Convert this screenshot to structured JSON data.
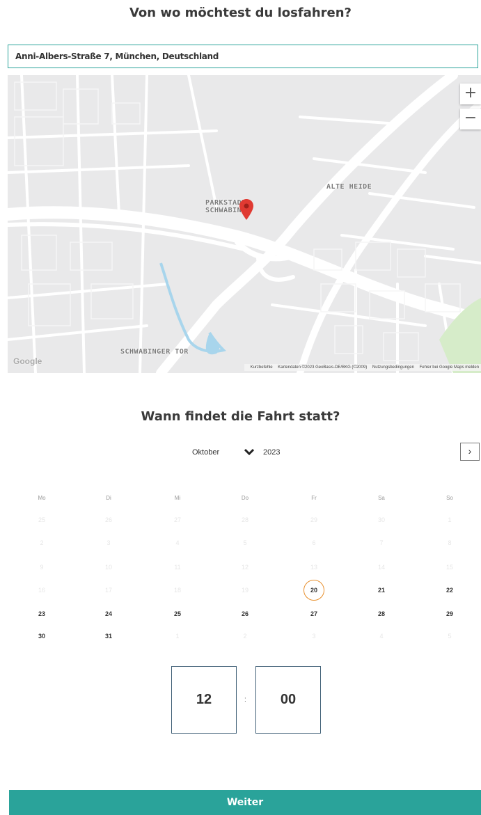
{
  "start": {
    "heading": "Von wo möchtest du losfahren?",
    "address_value": "Anni-Albers-Straße 7, München, Deutschland"
  },
  "map": {
    "zoom_in": "+",
    "zoom_out": "−",
    "labels": {
      "parkstadt_1": "PARKSTADT",
      "parkstadt_2": "SCHWABING",
      "alte_heide": "ALTE HEIDE",
      "schwabinger_tor": "SCHWABINGER TOR"
    },
    "logo": "Google",
    "attribution": {
      "shortcuts": "Kurzbefehle",
      "data": "Kartendaten ©2023 GeoBasis-DE/BKG (©2009)",
      "terms": "Nutzungsbedingungen",
      "report": "Fehler bei Google Maps melden"
    },
    "pin_color": "#e03a32"
  },
  "when": {
    "heading": "Wann findet die Fahrt statt?",
    "month": "Oktober",
    "caret": "⌄",
    "year": "2023",
    "next": "›",
    "weekdays": [
      "Mo",
      "Di",
      "Mi",
      "Do",
      "Fr",
      "Sa",
      "So"
    ],
    "weeks": [
      [
        {
          "d": "25",
          "m": true
        },
        {
          "d": "26",
          "m": true
        },
        {
          "d": "27",
          "m": true
        },
        {
          "d": "28",
          "m": true
        },
        {
          "d": "29",
          "m": true
        },
        {
          "d": "30",
          "m": true
        },
        {
          "d": "1",
          "m": true
        }
      ],
      [
        {
          "d": "2",
          "m": true
        },
        {
          "d": "3",
          "m": true
        },
        {
          "d": "4",
          "m": true
        },
        {
          "d": "5",
          "m": true
        },
        {
          "d": "6",
          "m": true
        },
        {
          "d": "7",
          "m": true
        },
        {
          "d": "8",
          "m": true
        }
      ],
      [
        {
          "d": "9",
          "m": true
        },
        {
          "d": "10",
          "m": true
        },
        {
          "d": "11",
          "m": true
        },
        {
          "d": "12",
          "m": true
        },
        {
          "d": "13",
          "m": true
        },
        {
          "d": "14",
          "m": true
        },
        {
          "d": "15",
          "m": true
        }
      ],
      [
        {
          "d": "16",
          "m": true
        },
        {
          "d": "17",
          "m": true
        },
        {
          "d": "18",
          "m": true
        },
        {
          "d": "19",
          "m": true
        },
        {
          "d": "20",
          "m": false,
          "sel": true
        },
        {
          "d": "21",
          "m": false
        },
        {
          "d": "22",
          "m": false
        }
      ],
      [
        {
          "d": "23",
          "m": false
        },
        {
          "d": "24",
          "m": false
        },
        {
          "d": "25",
          "m": false
        },
        {
          "d": "26",
          "m": false
        },
        {
          "d": "27",
          "m": false
        },
        {
          "d": "28",
          "m": false
        },
        {
          "d": "29",
          "m": false
        }
      ],
      [
        {
          "d": "30",
          "m": false
        },
        {
          "d": "31",
          "m": false
        },
        {
          "d": "1",
          "m": true
        },
        {
          "d": "2",
          "m": true
        },
        {
          "d": "3",
          "m": true
        },
        {
          "d": "4",
          "m": true
        },
        {
          "d": "5",
          "m": true
        }
      ]
    ],
    "hour": "12",
    "separator": ":",
    "minute": "00"
  },
  "button": {
    "weiter": "Weiter"
  },
  "colors": {
    "accent": "#2aa39a",
    "selected_ring": "#e8902e",
    "time_border": "#3f5f76"
  }
}
